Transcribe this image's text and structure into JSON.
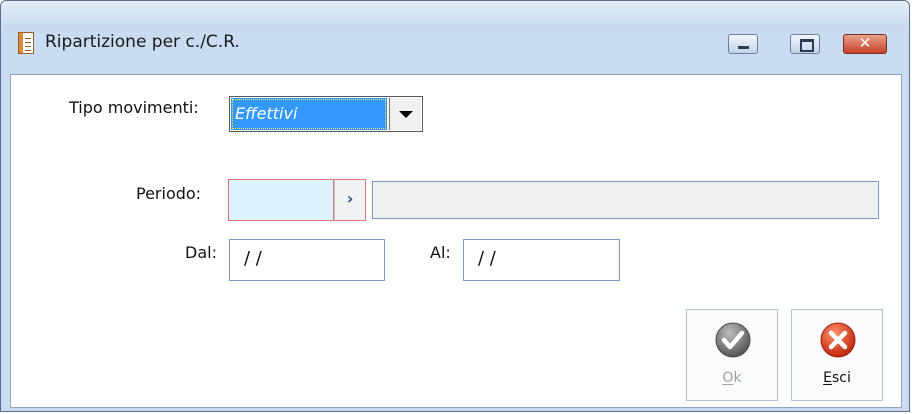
{
  "window": {
    "title": "Ripartizione per c./C.R.",
    "controls": {
      "minimize": "minimize-icon",
      "maximize": "maximize-icon",
      "close": "close-icon"
    }
  },
  "form": {
    "tipo_movimenti": {
      "label": "Tipo movimenti:",
      "selected": "Effettivi"
    },
    "periodo": {
      "label": "Periodo:",
      "code_value": "",
      "description_value": ""
    },
    "dal": {
      "label": "Dal:",
      "value": "/ /"
    },
    "al": {
      "label": "Al:",
      "value": "/ /"
    }
  },
  "buttons": {
    "ok": {
      "label_first": "O",
      "label_rest": "k",
      "enabled": false,
      "icon": "checkmark-icon"
    },
    "esci": {
      "label_first": "E",
      "label_rest": "sci",
      "enabled": true,
      "icon": "cancel-x-icon"
    }
  },
  "colors": {
    "titlebar": "#c7d9ef",
    "selection": "#3399ff",
    "required_field_border": "#e07474",
    "ok_icon": "#6e6e6e",
    "esci_icon": "#e0421f"
  }
}
